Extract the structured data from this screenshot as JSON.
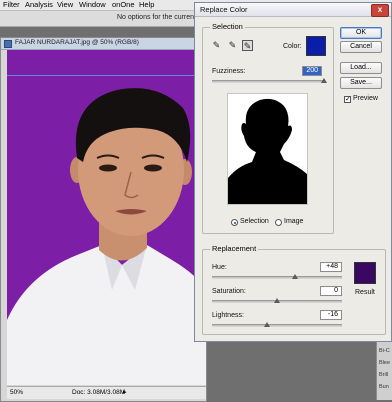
{
  "menu": [
    "Filter",
    "Analysis",
    "View",
    "Window",
    "onOne",
    "Help"
  ],
  "options_bar": {
    "message": "No options for the current tool."
  },
  "document": {
    "title": "FAJAR NURDARAJAT.jpg @ 50% (RGB/8)",
    "zoom": "50%",
    "doc_size": "Doc: 3.08M/3.08M",
    "canvas_color": "#7d1fa6"
  },
  "dialog": {
    "title": "Replace Color",
    "close_glyph": "x",
    "selection": {
      "label": "Selection",
      "color_label": "Color:",
      "color": "#0a1ea8",
      "fuzziness_label": "Fuzziness:",
      "fuzziness": "200",
      "fuzziness_fraction": 1.0,
      "view_selection": "Selection",
      "view_image": "Image",
      "selected_view": "Selection"
    },
    "buttons": {
      "ok": "OK",
      "cancel": "Cancel",
      "load": "Load...",
      "save": "Save..."
    },
    "preview_label": "Preview",
    "preview_checked": true,
    "replacement": {
      "label": "Replacement",
      "hue_label": "Hue:",
      "hue": "+48",
      "hue_fraction": 0.64,
      "saturation_label": "Saturation:",
      "saturation": "0",
      "saturation_fraction": 0.5,
      "lightness_label": "Lightness:",
      "lightness": "-16",
      "lightness_fraction": 0.42,
      "result_label": "Result",
      "result_color": "#3a0860"
    }
  },
  "side_panel_items": [
    "Bi-C",
    "Blee",
    "Brill",
    "Bun"
  ],
  "icons": {
    "eyedropper": "eyedropper-icon",
    "eyedropper_plus": "eyedropper-plus-icon",
    "eyedropper_minus": "eyedropper-minus-icon"
  }
}
